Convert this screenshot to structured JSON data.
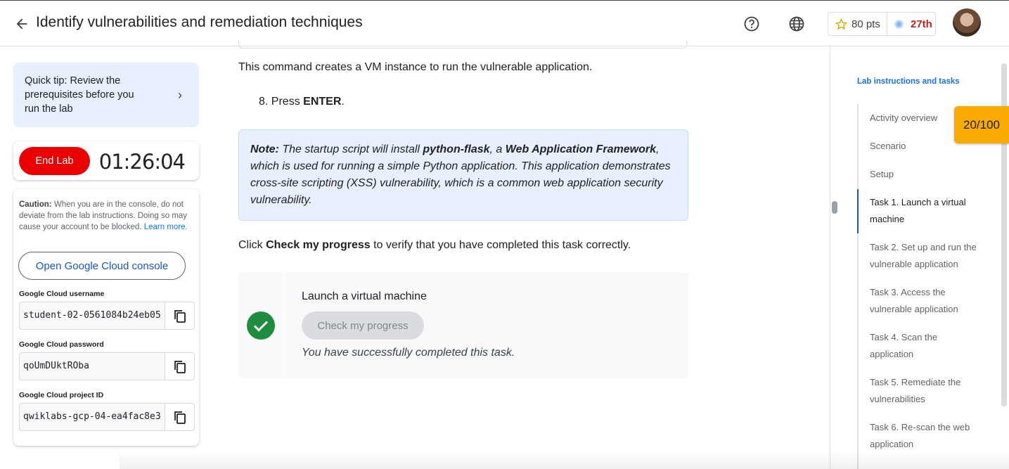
{
  "header": {
    "title": "Identify vulnerabilities and remediation techniques",
    "points": "80 pts",
    "rank": "27th"
  },
  "sidebar": {
    "tip": "Quick tip: Review the prerequisites before you run the lab",
    "end_lab_label": "End Lab",
    "timer": "01:26:04",
    "caution_bold": "Caution:",
    "caution_text": " When you are in the console, do not deviate from the lab instructions. Doing so may cause your account to be blocked.",
    "learn_more": "Learn more.",
    "console_button": "Open Google Cloud console",
    "credentials": [
      {
        "label": "Google Cloud username",
        "value": "student-02-0561084b24eb05"
      },
      {
        "label": "Google Cloud password",
        "value": "qoUmDUktROba"
      },
      {
        "label": "Google Cloud project ID",
        "value": "qwiklabs-gcp-04-ea4fac8e3c"
      }
    ]
  },
  "main": {
    "paragraph1": "This command creates a VM instance to run the vulnerable application.",
    "step_number": "8. Press ",
    "step_key": "ENTER",
    "step_end": ".",
    "note": {
      "label": "Note:",
      "part1": " The startup script will install ",
      "package": "python-flask",
      "part2": ", a ",
      "framework": "Web Application Framework",
      "part3": ", which is used for running a simple Python application. This application demonstrates cross-site scripting (XSS) vulnerability, which is a common web application security vulnerability."
    },
    "click_prefix": "Click",
    "click_bold": "Check my progress",
    "click_suffix": "to verify that you have completed this task correctly.",
    "task": {
      "title": "Launch a virtual machine",
      "button": "Check my progress",
      "status": "You have successfully completed this task."
    }
  },
  "nav": {
    "title": "Lab instructions and tasks",
    "score": "20/100",
    "items": [
      "Activity overview",
      "Scenario",
      "Setup",
      "Task 1. Launch a virtual machine",
      "Task 2. Set up and run the vulnerable application",
      "Task 3. Access the vulnerable application",
      "Task 4. Scan the application",
      "Task 5. Remediate the vulnerabilities",
      "Task 6. Re-scan the web application"
    ],
    "active_index": 3
  },
  "colors": {
    "accent": "#1a73e8",
    "end_lab": "#ea0000",
    "success": "#1e8e3e",
    "score_badge": "#f9ab00"
  }
}
